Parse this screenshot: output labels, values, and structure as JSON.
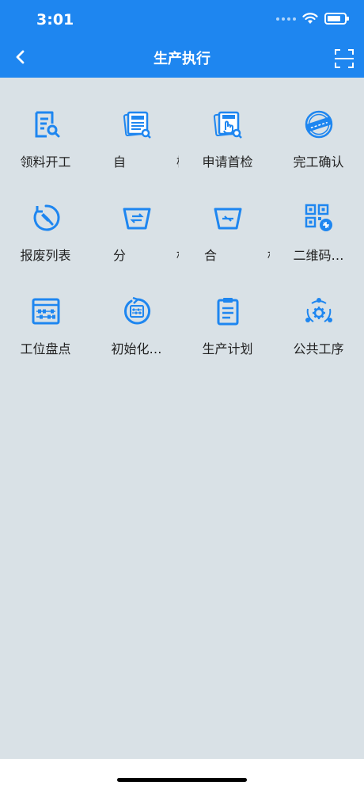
{
  "status_bar": {
    "time": "3:01"
  },
  "header": {
    "title": "生产执行"
  },
  "colors": {
    "primary": "#1e86f0",
    "background": "#d9e1e6"
  },
  "menu": [
    {
      "label": "领料开工",
      "icon": "material-checklist-icon"
    },
    {
      "label": "自　检",
      "icon": "self-inspection-icon"
    },
    {
      "label": "申请首检",
      "icon": "first-inspection-request-icon"
    },
    {
      "label": "完工确认",
      "icon": "completion-stamp-icon"
    },
    {
      "label": "报废列表",
      "icon": "scrap-hammer-icon"
    },
    {
      "label": "分　框",
      "icon": "split-box-icon"
    },
    {
      "label": "合　框",
      "icon": "merge-box-icon"
    },
    {
      "label": "二维码…",
      "icon": "qr-code-icon"
    },
    {
      "label": "工位盘点",
      "icon": "abacus-icon"
    },
    {
      "label": "初始化…",
      "icon": "initialize-abacus-icon"
    },
    {
      "label": "生产计划",
      "icon": "clipboard-icon"
    },
    {
      "label": "公共工序",
      "icon": "public-process-icon"
    }
  ]
}
